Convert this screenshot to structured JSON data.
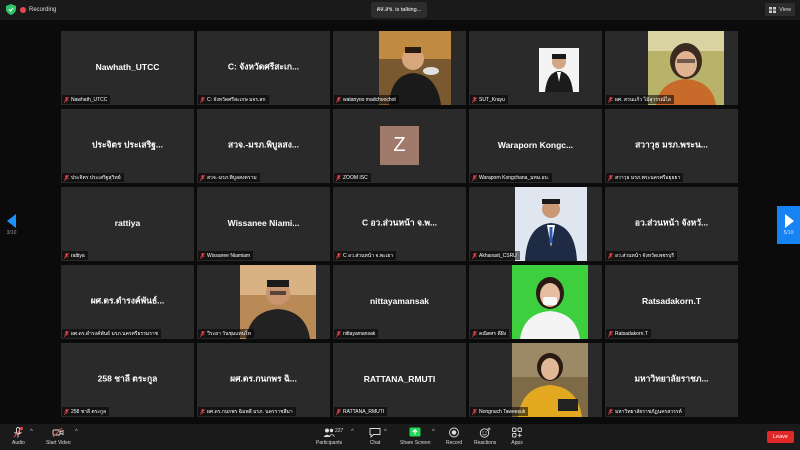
{
  "top_bar": {
    "recording_label": "Recording",
    "active_speaker": "ศส.สข. is talking...",
    "view_label": "View"
  },
  "pagination": {
    "left_page": "3/10",
    "right_page": "5/10"
  },
  "tiles": [
    {
      "big_name": "Nawhath_UTCC",
      "label": "Nawhath_UTCC"
    },
    {
      "big_name": "C: จังหวัดศรีสะเก...",
      "label": "C: จังหวัดศรีสะเกษ มจร.สก"
    },
    {
      "big_name": "",
      "label": "watanyoo madchoochot"
    },
    {
      "big_name": "",
      "label": "SUT_Krayu"
    },
    {
      "big_name": "",
      "label": "ผศ. สวนแก้ว ไม้สุวรรณ์ไล"
    },
    {
      "big_name": "ประจิตร ประเสริฐ...",
      "label": "ประจิตร ประเสริฐสุวิทย์"
    },
    {
      "big_name": "สวจ.-มรภ.พิบูลสง...",
      "label": "สวจ.-มรภ.พิบูลสงคราม"
    },
    {
      "big_name": "",
      "label": "ZOOM ISC",
      "avatar_letter": "Z"
    },
    {
      "big_name": "Waraporn Kongc...",
      "label": "Waraporn Kongchana_มหม.อบ."
    },
    {
      "big_name": "สวาวุธ มรภ.พระน...",
      "label": "สวาวุธ มรภ.พระนครศรีอยุธยา"
    },
    {
      "big_name": "rattiya",
      "label": "rattiya"
    },
    {
      "big_name": "Wissanee Niami...",
      "label": "Wissanee Niamiam"
    },
    {
      "big_name": "C อว.ส่วนหน้า จ.พ...",
      "label": "C อว.ส่วนหน้า จ.พะเยา"
    },
    {
      "big_name": "",
      "label": "Akharasit_CSRU"
    },
    {
      "big_name": "อว.ส่วนหน้า จังหวั...",
      "label": "อว.ส่วนหน้า จังหวัดเพชรบุรี"
    },
    {
      "big_name": "ผศ.ดร.ดำรงค์พันธ์...",
      "label": "ผศ.ดร.ดำรงค์พันธ์ มรภ.นครศรีธรรมราช"
    },
    {
      "big_name": "",
      "label": "วีระยา วันชุมแทนไท"
    },
    {
      "big_name": "nittayamansak",
      "label": "nittayamansak"
    },
    {
      "big_name": "",
      "label": "คณิตศร ดีฝัง"
    },
    {
      "big_name": "Ratsadakorn.T",
      "label": "Ratsadakorn.T"
    },
    {
      "big_name": "258 ชาลี ตระกูล",
      "label": "258 ชาลี ตระกูล"
    },
    {
      "big_name": "ผศ.ดร.กนกพร ฉิ...",
      "label": "ผศ.ดร.กนกพร ฉิมพลี มรภ. นครราชสีมา"
    },
    {
      "big_name": "RATTANA_RMUTI",
      "label": "RATTANA_RMUTI"
    },
    {
      "big_name": "",
      "label": "Nongnuch Taweesuk"
    },
    {
      "big_name": "มหาวิทยาลัยราชภ...",
      "label": "มหาวิทยาลัยราชภัฏนครสวรรค์"
    }
  ],
  "toolbar": {
    "audio_label": "Audio",
    "video_label": "Start Video",
    "participants_label": "Participants",
    "participants_count": "227",
    "chat_label": "Chat",
    "share_label": "Share Screen",
    "record_label": "Record",
    "reactions_label": "Reactions",
    "apps_label": "Apps",
    "leave_label": "Leave"
  },
  "colors": {
    "share_green": "#23d959",
    "leave_red": "#e02828",
    "nav_blue": "#1683f5",
    "tile_bg": "#2a2a2a"
  }
}
